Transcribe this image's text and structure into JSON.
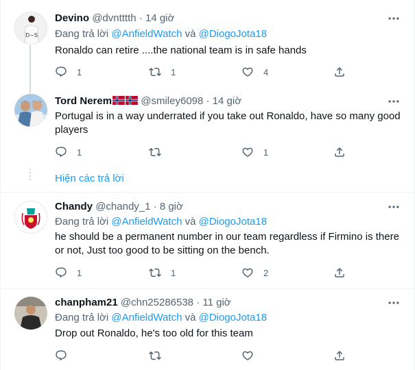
{
  "reply_prefix": "Đang trả lời",
  "conj": "và",
  "show_replies": "Hiện các trả lời",
  "tweets": [
    {
      "name": "Devino",
      "handle": "@dvntttth",
      "sep": "·",
      "time": "14 giờ",
      "reply_to": [
        "@AnfieldWatch",
        "@DiogoJota18"
      ],
      "text": "Ronaldo can retire ....the national team is in safe hands",
      "replies": "1",
      "retweets": "1",
      "likes": "4"
    },
    {
      "name": "Tord Nerem",
      "flags": [
        "norway-flag-icon",
        "norway-flag-icon"
      ],
      "handle": "@smiley6098",
      "sep": "·",
      "time": "14 giờ",
      "text": "Portugal is in a way underrated if you take out Ronaldo, have so many good players",
      "replies": "1",
      "retweets": "",
      "likes": "1"
    },
    {
      "name": "Chandy",
      "handle": "@chandy_1",
      "sep": "·",
      "time": "8 giờ",
      "reply_to": [
        "@AnfieldWatch",
        "@DiogoJota18"
      ],
      "text": "he should be a permanent number in our team regardless if Firmino is there or not, Just too good to be sitting on the bench.",
      "replies": "1",
      "retweets": "1",
      "likes": "2"
    },
    {
      "name": "chanpham21",
      "handle": "@chn25286538",
      "sep": "·",
      "time": "11 giờ",
      "reply_to": [
        "@AnfieldWatch",
        "@DiogoJota18"
      ],
      "text": "Drop out Ronaldo, he's too old for this team",
      "replies": "",
      "retweets": "",
      "likes": ""
    }
  ],
  "colors": {
    "link": "#1d9bf0",
    "muted": "#536471",
    "border": "#eff3f4",
    "liverpool_red": "#c8102e"
  }
}
